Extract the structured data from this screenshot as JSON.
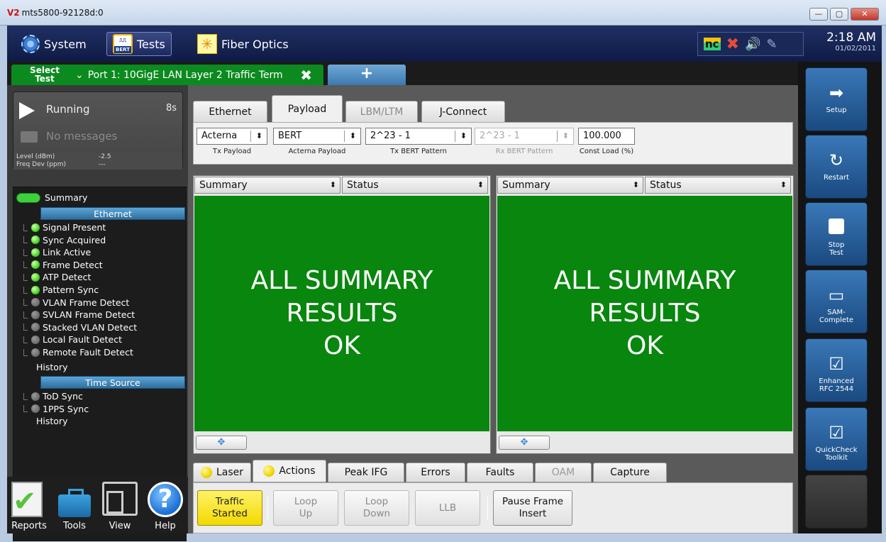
{
  "window": {
    "title_prefix": "V2",
    "title": "mts5800-92128d:0",
    "min": "—",
    "max": "▢",
    "close": "✕"
  },
  "appbar": {
    "system": "System",
    "tests": "Tests",
    "bert_icon_text": "BERT",
    "fiber": "Fiber Optics",
    "nc": "nc",
    "time": "2:18 AM",
    "date": "01/02/2011"
  },
  "tabs": {
    "select_test": "Select Test",
    "port_tab": "Port 1: 10GigE LAN Layer 2 Traffic Term",
    "add": "+"
  },
  "run": {
    "state": "Running",
    "time": "8s",
    "messages": "No messages",
    "level_label": "Level (dBm)",
    "level_value": "-2.5",
    "freq_label": "Freq Dev (ppm)",
    "freq_value": "---"
  },
  "tree": {
    "summary": "Summary",
    "ethernet": "Ethernet",
    "items": [
      {
        "label": "Signal Present",
        "on": true
      },
      {
        "label": "Sync Acquired",
        "on": true
      },
      {
        "label": "Link Active",
        "on": true
      },
      {
        "label": "Frame Detect",
        "on": true
      },
      {
        "label": "ATP Detect",
        "on": true
      },
      {
        "label": "Pattern Sync",
        "on": true
      },
      {
        "label": "VLAN Frame Detect",
        "on": false
      },
      {
        "label": "SVLAN Frame Detect",
        "on": false
      },
      {
        "label": "Stacked VLAN Detect",
        "on": false
      },
      {
        "label": "Local Fault Detect",
        "on": false
      },
      {
        "label": "Remote Fault Detect",
        "on": false
      }
    ],
    "history": "History",
    "time_source": "Time Source",
    "ts_items": [
      {
        "label": "ToD Sync",
        "on": false
      },
      {
        "label": "1PPS Sync",
        "on": false
      }
    ],
    "history2": "History"
  },
  "bottom_icons": {
    "reports": "Reports",
    "tools": "Tools",
    "view": "View",
    "help": "Help"
  },
  "top_tabs": {
    "ethernet": "Ethernet",
    "payload": "Payload",
    "lbm": "LBM/LTM",
    "jconnect": "J-Connect"
  },
  "settings": {
    "tx_payload_value": "Acterna",
    "tx_payload_label": "Tx Payload",
    "acterna_payload_value": "BERT",
    "acterna_payload_label": "Acterna Payload",
    "tx_bert_value": "2^23 - 1",
    "tx_bert_label": "Tx BERT Pattern",
    "rx_bert_value": "2^23 - 1",
    "rx_bert_label": "Rx BERT Pattern",
    "const_load_value": "100.000",
    "const_load_label": "Const Load (%)"
  },
  "panes": {
    "left": {
      "cat": "Summary",
      "view": "Status",
      "line1": "ALL SUMMARY",
      "line2": "RESULTS",
      "line3": "OK"
    },
    "right": {
      "cat": "Summary",
      "view": "Status",
      "line1": "ALL SUMMARY",
      "line2": "RESULTS",
      "line3": "OK"
    }
  },
  "bottom_tabs": {
    "laser": "Laser",
    "actions": "Actions",
    "peak_ifg": "Peak IFG",
    "errors": "Errors",
    "faults": "Faults",
    "oam": "OAM",
    "capture": "Capture"
  },
  "actions": {
    "traffic1": "Traffic",
    "traffic2": "Started",
    "loopup1": "Loop",
    "loopup2": "Up",
    "loopdown1": "Loop",
    "loopdown2": "Down",
    "llb": "LLB",
    "pause1": "Pause Frame",
    "pause2": "Insert"
  },
  "right_buttons": {
    "setup": "Setup",
    "restart": "Restart",
    "stop1": "Stop",
    "stop2": "Test",
    "sam1": "SAM-",
    "sam2": "Complete",
    "rfc1": "Enhanced",
    "rfc2": "RFC 2544",
    "qc1": "QuickCheck",
    "qc2": "Toolkit"
  }
}
